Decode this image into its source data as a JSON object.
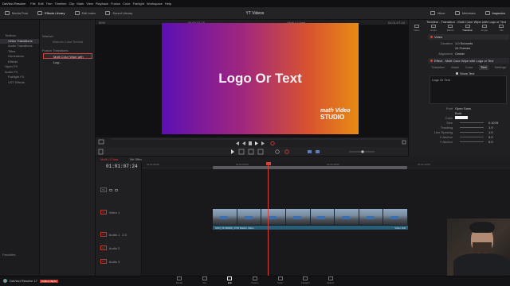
{
  "app": {
    "name": "DaVinci Resolve",
    "menu": [
      "File",
      "Edit",
      "Trim",
      "Timeline",
      "Clip",
      "Mark",
      "View",
      "Playback",
      "Fusion",
      "Color",
      "Fairlight",
      "Workspace",
      "Help"
    ]
  },
  "toolbar": {
    "project_title": "YT Videos",
    "left_buttons": [
      "Media Pool",
      "Effects Library",
      "Edit Index",
      "Sound Library"
    ],
    "right_buttons": [
      "Mixer",
      "Metadata",
      "Inspector"
    ]
  },
  "effects": {
    "tree": [
      {
        "label": "Toolbox",
        "child": false
      },
      {
        "label": "Video Transitions",
        "child": true,
        "selected": true
      },
      {
        "label": "Audio Transitions",
        "child": true
      },
      {
        "label": "Titles",
        "child": true
      },
      {
        "label": "Generators",
        "child": true
      },
      {
        "label": "Effects",
        "child": true
      },
      {
        "label": "Open FX",
        "child": false
      },
      {
        "label": "Audio FX",
        "child": false
      },
      {
        "label": "Fairlight FX",
        "child": true
      },
      {
        "label": "VST Effects",
        "child": true
      }
    ],
    "groups": [
      {
        "name": "Wrench",
        "entries": [
          "Wrench Color Reveal"
        ]
      },
      {
        "name": "Fusion Transitions",
        "entries": [
          "Multi Color Wipe with Log..."
        ]
      }
    ],
    "favorites_label": "Favorites"
  },
  "viewer": {
    "zoom": "50%",
    "source_tc": "00:00:37:15",
    "timeline_name": "Multi LO fast",
    "record_tc": "01:01:07:24",
    "overlay_text": "Logo Or Text",
    "brand_top": "math Video",
    "brand_bottom": "STUDIO"
  },
  "inspector": {
    "title": "Timeline - Transition - Multi Color Wipe with Logo or Text",
    "tabs": [
      "Video",
      "Audio",
      "Effects",
      "Transition",
      "Image",
      "File"
    ],
    "active_tab": "Transition",
    "video_section": "Video",
    "video_props": [
      {
        "label": "Duration",
        "value": "1.0   Seconds"
      },
      {
        "label": "",
        "value": "24   Frames"
      },
      {
        "label": "Alignment",
        "value": "Center"
      }
    ],
    "effect_section": "Effect - Multi Color Wipe with Logo or Text",
    "sub_tabs": [
      "Transition",
      "Mask",
      "Color",
      "Text",
      "Settings"
    ],
    "active_sub_tab": "Text",
    "show_text_label": "Show Text",
    "text_field_value": "Logo Or Text",
    "text_props": [
      {
        "label": "Font",
        "value": "Open Sans"
      },
      {
        "label": "",
        "value": "Bold"
      },
      {
        "label": "Color",
        "value": ""
      },
      {
        "label": "Size",
        "value": "0.1078"
      },
      {
        "label": "Tracking",
        "value": "1.0"
      },
      {
        "label": "Line Spacing",
        "value": "1.0"
      },
      {
        "label": "X Anchor",
        "value": "0.0"
      },
      {
        "label": "Y Anchor",
        "value": "0.0"
      }
    ]
  },
  "timeline": {
    "tabs": [
      "Multi LO fast",
      "3th Offer"
    ],
    "active_tab": "Multi LO fast",
    "timecode": "01:01:07:24",
    "ruler_marks": [
      "01:01:00:00",
      "01:01:04:00",
      "01:01:08:00",
      "01:01:12:00"
    ],
    "tracks": [
      {
        "tag": "V2",
        "name": "",
        "type": "video"
      },
      {
        "tag": "V1",
        "name": "Video 1",
        "type": "video"
      },
      {
        "tag": "A1",
        "name": "Audio 1",
        "type": "audio",
        "level": "2.0"
      },
      {
        "tag": "A2",
        "name": "Audio 2",
        "type": "audio",
        "level": ""
      },
      {
        "tag": "A3",
        "name": "Audio 3",
        "type": "audio",
        "level": ""
      }
    ],
    "audio_clip_label": "MVR_FF-B0009_1725 Master Video",
    "audio_clip_right": "Video Roll"
  },
  "pages": {
    "items": [
      "Media",
      "Cut",
      "Edit",
      "Fusion",
      "Color",
      "Fairlight",
      "Deliver"
    ],
    "active": "Edit"
  },
  "brand_strip": {
    "name": "DaVinci Resolve 17",
    "badge": "PUBLIC BETA"
  }
}
